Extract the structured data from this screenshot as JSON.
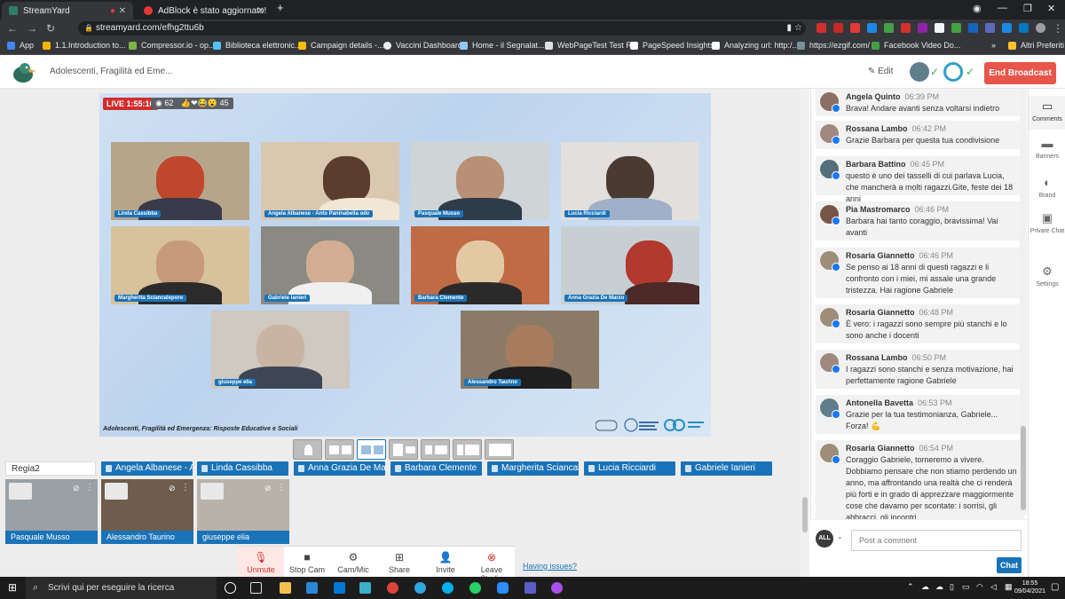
{
  "browser": {
    "tabs": [
      {
        "title": "StreamYard",
        "active": true
      },
      {
        "title": "AdBlock è stato aggiornato!",
        "active": false
      }
    ],
    "url": "streamyard.com/efhg2ttu6b",
    "bookmarks": [
      "App",
      "1.1.Introduction to...",
      "Compressor.io - op...",
      "Biblioteca elettronic...",
      "Campaign details -...",
      "Vaccini Dashboard",
      "Home - il Segnalat...",
      "WebPageTest Test R...",
      "PageSpeed Insights",
      "Analyzing url: http:/...",
      "https://ezgif.com/",
      "Facebook Video Do...",
      "Altri Preferiti"
    ],
    "bookmarks_more": "»"
  },
  "app": {
    "broadcast_title": "Adolescenti, Fragilità ed Eme...",
    "edit_label": "Edit",
    "end_label": "End Broadcast"
  },
  "stage": {
    "live_label": "LIVE 1:55:16",
    "views": "62",
    "reactions": "45",
    "caption": "Adolescenti, Fragilità ed Emergenza: Risposte Educative e Sociali",
    "participants": [
      "Linda Cassibba",
      "Angela Albanese - Anto Paninabella odv",
      "Pasquale Musso",
      "Lucia Ricciardi",
      "Margherita Sciancalepore",
      "Gabriele Ianieri",
      "Barbara Clemente",
      "Anna Grazia De Marzo",
      "giuseppe elia",
      "Alessandro Taurino"
    ]
  },
  "guest_pills": [
    "Regia2",
    "Angela Albanese - An...",
    "Linda Cassibba",
    "Anna Grazia De Marzo",
    "Barbara Clemente",
    "Margherita Sciancale...",
    "Lucia Ricciardi",
    "Gabriele Ianieri"
  ],
  "backstage": [
    "Pasquale Musso",
    "Alessandro Taurino",
    "giuseppe elia"
  ],
  "toolbar": {
    "unmute": "Unmute",
    "stop_cam": "Stop Cam",
    "cam_mic": "Cam/Mic",
    "share": "Share",
    "invite": "Invite",
    "leave": "Leave Studio",
    "issues": "Having issues?"
  },
  "comments": [
    {
      "name": "Angela Quinto",
      "time": "06:39 PM",
      "text": "Brava! Andare avanti senza voltarsi indietro"
    },
    {
      "name": "Rossana Lambo",
      "time": "06:42 PM",
      "text": "Grazie Barbara per questa tua condivisione"
    },
    {
      "name": "Barbara Battino",
      "time": "06:45 PM",
      "text": "questo è uno dei tasselli di cui parlava Lucia, che mancherà a molti ragazzi.Gite, feste dei 18 anni"
    },
    {
      "name": "Pia Mastromarco",
      "time": "06:46 PM",
      "text": "Barbara hai tanto coraggio, bravissima! Vai avanti"
    },
    {
      "name": "Rosaria Giannetto",
      "time": "06:46 PM",
      "text": "Se penso ai 18 anni di questi ragazzi e li confronto con i miei, mi assale una grande tristezza. Hai ragione Gabriele"
    },
    {
      "name": "Rosaria Giannetto",
      "time": "06:48 PM",
      "text": "È vero: i ragazzi sono sempre più stanchi e lo sono anche i docenti"
    },
    {
      "name": "Rossana Lambo",
      "time": "06:50 PM",
      "text": "I ragazzi sono stanchi e senza motivazione, hai perfettamente ragione Gabriele"
    },
    {
      "name": "Antonella Bavetta",
      "time": "06:53 PM",
      "text": "Grazie per la tua testimonianza, Gabriele... Forza! 💪"
    },
    {
      "name": "Rosaria Giannetto",
      "time": "06:54 PM",
      "text": "Coraggio Gabriele, torneremo a vivere. Dobbiamo pensare che non stiamo perdendo un anno, ma affrontando una realtà che ci renderà più forti e in grado di apprezzare maggiormente cose che davamo per scontate: i sorrisi, gli abbracci, gli incontri ...."
    }
  ],
  "chat": {
    "all_label": "ALL",
    "placeholder": "Post a comment",
    "send": "Chat"
  },
  "rail": [
    "Comments",
    "Banners",
    "Brand",
    "Private Chat",
    "Settings"
  ],
  "taskbar": {
    "search_placeholder": "Scrivi qui per eseguire la ricerca",
    "time": "18:55",
    "date": "09/04/2021"
  }
}
